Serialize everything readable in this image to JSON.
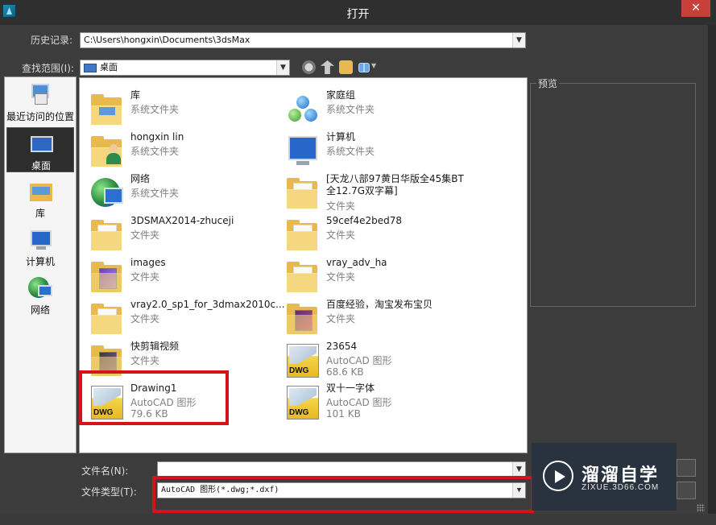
{
  "window": {
    "title": "打开",
    "close_label": "✕"
  },
  "history": {
    "label": "历史记录:",
    "value": "C:\\Users\\hongxin\\Documents\\3dsMax"
  },
  "lookin": {
    "label": "查找范围(I):",
    "value": "桌面"
  },
  "toolbar": {
    "icons": [
      "back-icon",
      "up-folder-icon",
      "new-folder-icon",
      "view-menu-icon"
    ]
  },
  "places": [
    {
      "label": "最近访问的位置",
      "icon": "recent-places-icon"
    },
    {
      "label": "桌面",
      "icon": "desktop-icon",
      "selected": true
    },
    {
      "label": "库",
      "icon": "libraries-icon"
    },
    {
      "label": "计算机",
      "icon": "computer-icon"
    },
    {
      "label": "网络",
      "icon": "network-icon"
    }
  ],
  "files": [
    {
      "name": "库",
      "type": "系统文件夹",
      "icon": "libraries-folder-icon"
    },
    {
      "name": "家庭组",
      "type": "系统文件夹",
      "icon": "homegroup-icon"
    },
    {
      "name": "hongxin lin",
      "type": "系统文件夹",
      "icon": "user-folder-icon"
    },
    {
      "name": "计算机",
      "type": "系统文件夹",
      "icon": "computer-icon"
    },
    {
      "name": "网络",
      "type": "系统文件夹",
      "icon": "network-icon"
    },
    {
      "name": "[天龙八部97黄日华版全45集BT全12.7G双字幕]",
      "type": "文件夹",
      "icon": "folder-icon"
    },
    {
      "name": "3DSMAX2014-zhuceji",
      "type": "文件夹",
      "icon": "folder-icon"
    },
    {
      "name": "59cef4e2bed78",
      "type": "文件夹",
      "icon": "folder-icon"
    },
    {
      "name": "images",
      "type": "文件夹",
      "icon": "images-folder-icon"
    },
    {
      "name": "vray_adv_ha",
      "type": "文件夹",
      "icon": "folder-icon"
    },
    {
      "name": "vray2.0_sp1_for_3dmax2010c...",
      "type": "文件夹",
      "icon": "folder-icon"
    },
    {
      "name": "百度经验，淘宝发布宝贝",
      "type": "文件夹",
      "icon": "image-folder-icon"
    },
    {
      "name": "快剪辑视频",
      "type": "文件夹",
      "icon": "video-folder-icon"
    },
    {
      "name": "23654",
      "type": "AutoCAD 图形",
      "size": "68.6 KB",
      "icon": "dwg-file-icon"
    },
    {
      "name": "Drawing1",
      "type": "AutoCAD 图形",
      "size": "79.6 KB",
      "icon": "dwg-file-icon"
    },
    {
      "name": "双十一字体",
      "type": "AutoCAD 图形",
      "size": "101 KB",
      "icon": "dwg-file-icon"
    }
  ],
  "preview": {
    "label": "预览"
  },
  "filename": {
    "label": "文件名(N):",
    "value": ""
  },
  "filetype": {
    "label": "文件类型(T):",
    "value": "AutoCAD 图形(*.dwg;*.dxf)"
  },
  "watermark": {
    "title": "溜溜自学",
    "subtitle": "ZIXUE.3D66.COM"
  },
  "highlight_color": "#d4131b"
}
